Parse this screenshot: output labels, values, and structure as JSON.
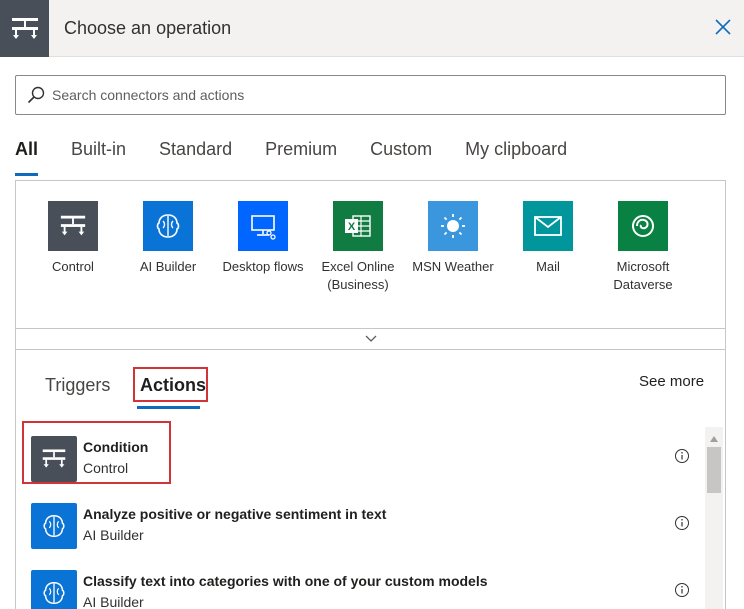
{
  "header": {
    "title": "Choose an operation"
  },
  "search": {
    "placeholder": "Search connectors and actions"
  },
  "tabs": [
    {
      "label": "All",
      "active": true
    },
    {
      "label": "Built-in"
    },
    {
      "label": "Standard"
    },
    {
      "label": "Premium"
    },
    {
      "label": "Custom"
    },
    {
      "label": "My clipboard"
    }
  ],
  "connectors": [
    {
      "label": "Control",
      "icon": "control-icon",
      "color": "#484f58"
    },
    {
      "label": "AI Builder",
      "icon": "brain-icon",
      "color": "#0a74d6"
    },
    {
      "label": "Desktop flows",
      "icon": "desktop-flows-icon",
      "color": "#0066ff"
    },
    {
      "label": "Excel Online (Business)",
      "icon": "excel-icon",
      "color": "#107c41"
    },
    {
      "label": "MSN Weather",
      "icon": "sun-icon",
      "color": "#3a96dd"
    },
    {
      "label": "Mail",
      "icon": "mail-icon",
      "color": "#00969c"
    },
    {
      "label": "Microsoft Dataverse",
      "icon": "dataverse-icon",
      "color": "#088142"
    }
  ],
  "sub_tabs": {
    "triggers": "Triggers",
    "actions": "Actions",
    "active": "actions"
  },
  "see_more": "See more",
  "actions": [
    {
      "title": "Condition",
      "subtitle": "Control",
      "icon": "control-icon",
      "color": "#484f58"
    },
    {
      "title": "Analyze positive or negative sentiment in text",
      "subtitle": "AI Builder",
      "icon": "brain-icon",
      "color": "#0a74d6"
    },
    {
      "title": "Classify text into categories with one of your custom models",
      "subtitle": "AI Builder",
      "icon": "brain-icon",
      "color": "#0a74d6"
    }
  ],
  "colors": {
    "accent": "#0f6cbd",
    "highlight": "#d13438"
  }
}
